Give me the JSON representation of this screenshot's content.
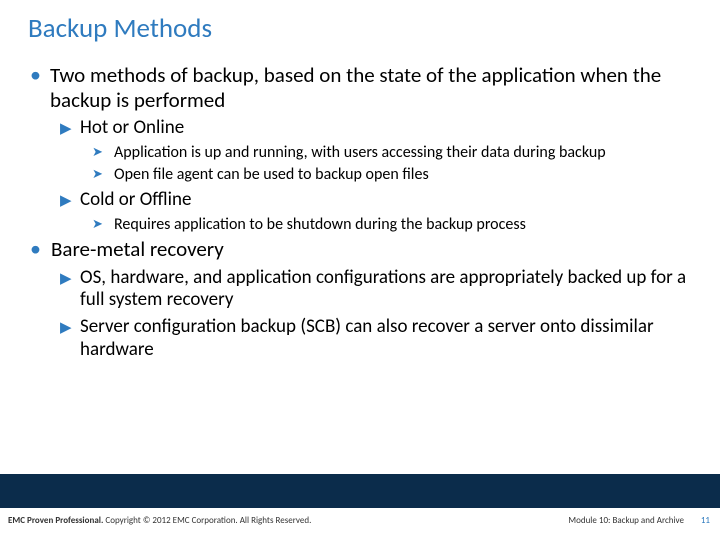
{
  "title": "Backup Methods",
  "b1": {
    "text": "Two methods of backup, based on the state of the application when the backup is performed",
    "s1": {
      "text": "Hot or Online",
      "d1": "Application is up and running, with users accessing their data during backup",
      "d2": "Open file agent can be used to backup open files"
    },
    "s2": {
      "text": "Cold or Offline",
      "d1": "Requires application to be shutdown during the backup process"
    }
  },
  "b2": {
    "text": "Bare-metal recovery",
    "s1": {
      "text": "OS, hardware, and application configurations are appropriately backed up for a full system recovery"
    },
    "s2": {
      "text": "Server configuration backup (SCB) can also recover a server onto dissimilar hardware"
    }
  },
  "footer": {
    "brand": "EMC Proven Professional.",
    "rest": " Copyright © 2012 EMC Corporation. All Rights Reserved.",
    "module": "Module 10: Backup and Archive",
    "page": "11"
  }
}
